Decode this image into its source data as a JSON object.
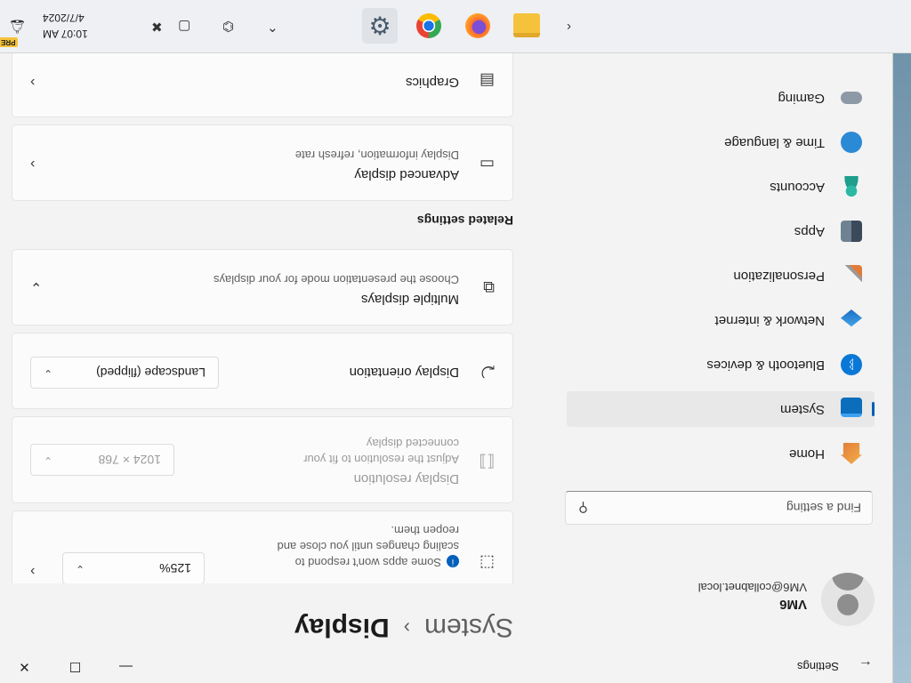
{
  "window": {
    "title": "Settings",
    "back_icon": "back-arrow-icon",
    "controls": {
      "minimize": "—",
      "maximize": "☐",
      "close": "✕"
    }
  },
  "profile": {
    "name": "VM6",
    "email": "VM6@collabnet.local"
  },
  "search": {
    "placeholder": "Find a setting",
    "icon": "search-icon"
  },
  "sidebar": {
    "items": [
      {
        "label": "Home",
        "icon": "home-icon",
        "color": "#e8912b",
        "active": false
      },
      {
        "label": "System",
        "icon": "system-icon",
        "color": "#0078d4",
        "active": true
      },
      {
        "label": "Bluetooth & devices",
        "icon": "bluetooth-icon",
        "color": "#0078d4",
        "active": false
      },
      {
        "label": "Network & internet",
        "icon": "network-icon",
        "color": "#2a8ad6",
        "active": false
      },
      {
        "label": "Personalization",
        "icon": "brush-icon",
        "color": "#e07b39",
        "active": false
      },
      {
        "label": "Apps",
        "icon": "apps-icon",
        "color": "#5a6b7c",
        "active": false
      },
      {
        "label": "Accounts",
        "icon": "accounts-icon",
        "color": "#2cb8a5",
        "active": false
      },
      {
        "label": "Time & language",
        "icon": "clock-globe-icon",
        "color": "#2a8ad6",
        "active": false
      },
      {
        "label": "Gaming",
        "icon": "gamepad-icon",
        "color": "#7a8896",
        "active": false
      }
    ]
  },
  "breadcrumb": {
    "parent": "System",
    "separator": "›",
    "current": "Display"
  },
  "settings": {
    "scale": {
      "warning": "Some apps won't respond to scaling changes until you close and reopen them.",
      "value": "125%"
    },
    "resolution": {
      "title": "Display resolution",
      "desc": "Adjust the resolution to fit your connected display",
      "value": "1024 × 768"
    },
    "orientation": {
      "title": "Display orientation",
      "value": "Landscape (flipped)"
    },
    "multiple": {
      "title": "Multiple displays",
      "desc": "Choose the presentation mode for your displays"
    }
  },
  "related": {
    "title": "Related settings",
    "advanced": {
      "title": "Advanced display",
      "desc": "Display information, refresh rate"
    },
    "graphics": {
      "title": "Graphics"
    }
  },
  "taskbar": {
    "apps": [
      {
        "name": "settings",
        "icon": "gear-icon",
        "active": true
      },
      {
        "name": "chrome",
        "icon": "chrome-icon",
        "active": false
      },
      {
        "name": "firefox",
        "icon": "firefox-icon",
        "active": false
      },
      {
        "name": "file-explorer",
        "icon": "folder-icon",
        "active": false
      }
    ],
    "clock": {
      "time": "10:07 AM",
      "date": "4/7/2024"
    },
    "badge": "PRE"
  }
}
